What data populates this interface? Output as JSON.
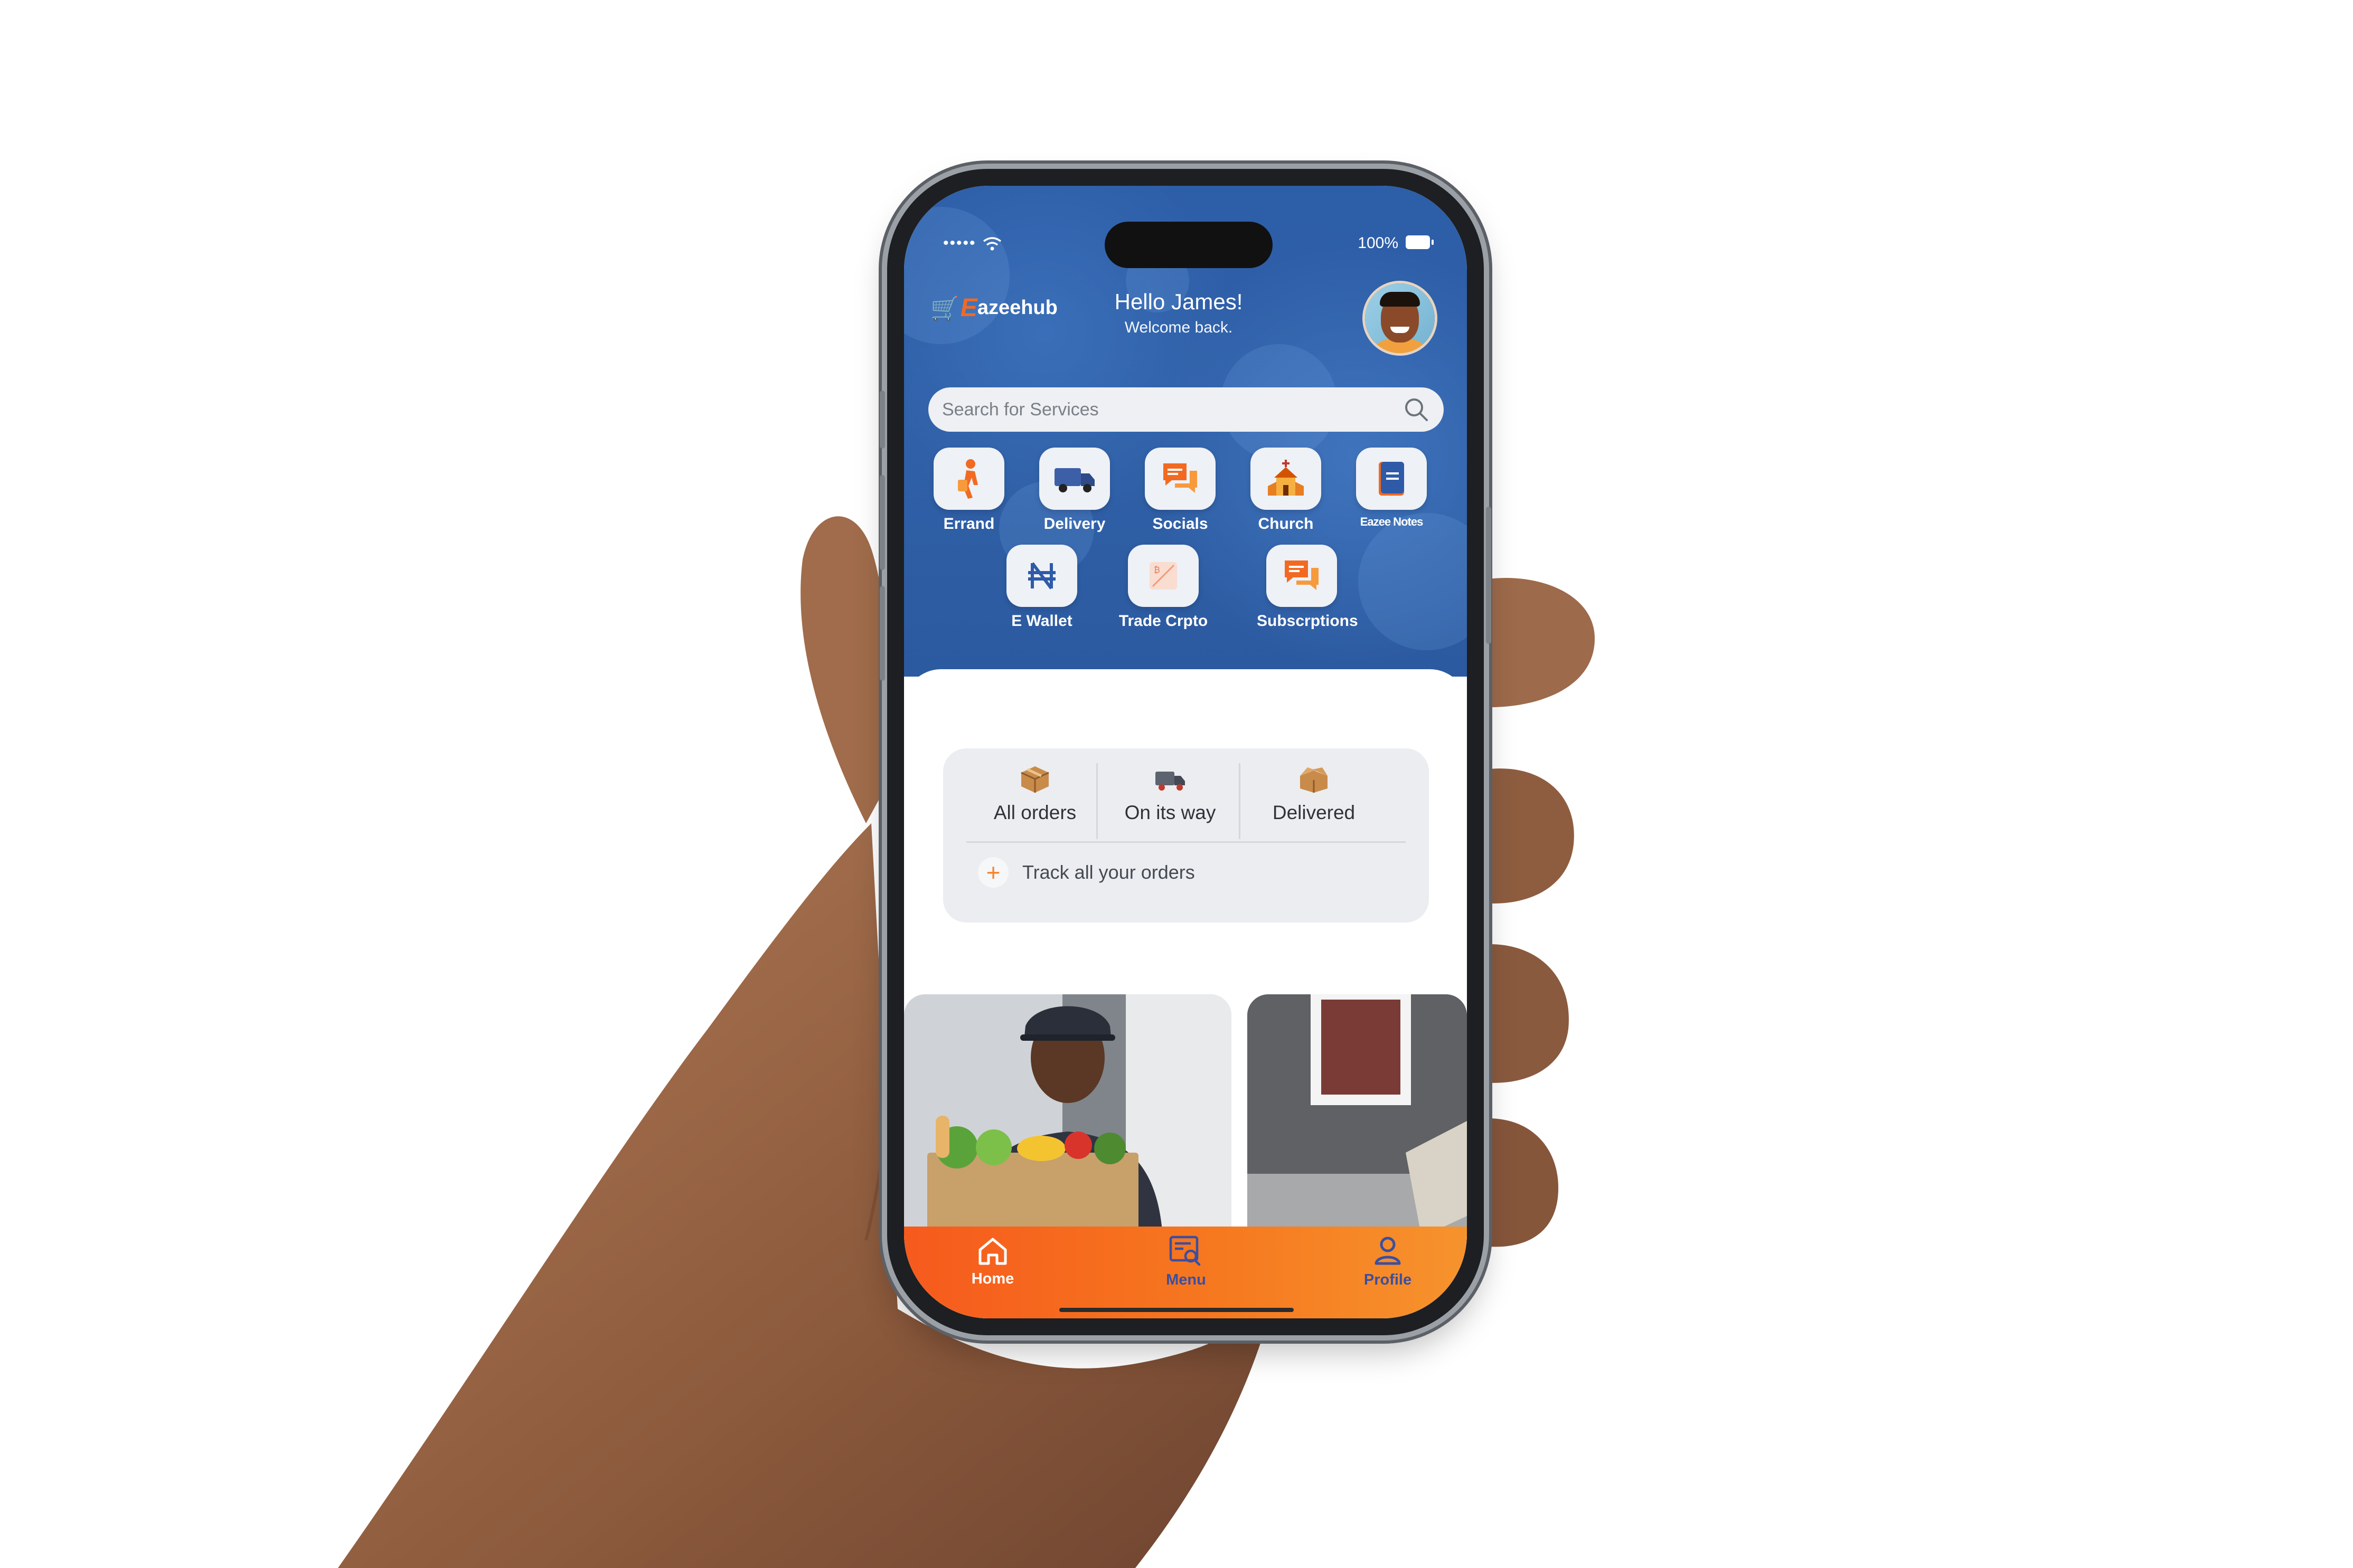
{
  "status_bar": {
    "signal": "•••••",
    "battery": "100%"
  },
  "header": {
    "logo_prefix": "E",
    "logo_text": "azeehub",
    "greeting": "Hello James!",
    "subtitle": "Welcome back."
  },
  "search": {
    "placeholder": "Search for Services"
  },
  "services": [
    {
      "label": "Errand",
      "icon": "walking-person-icon"
    },
    {
      "label": "Delivery",
      "icon": "delivery-truck-icon"
    },
    {
      "label": "Socials",
      "icon": "chat-bubbles-icon"
    },
    {
      "label": "Church",
      "icon": "church-icon"
    },
    {
      "label": "Eazee Notes",
      "icon": "notes-icon"
    },
    {
      "label": "E Wallet",
      "icon": "naira-icon"
    },
    {
      "label": "Trade Crpto",
      "icon": "crypto-icon"
    },
    {
      "label": "Subscrptions",
      "icon": "chat-bubbles-icon"
    }
  ],
  "orders": {
    "tabs": [
      {
        "label": "All orders",
        "icon": "package-icon"
      },
      {
        "label": "On its way",
        "icon": "truck-icon"
      },
      {
        "label": "Delivered",
        "icon": "open-package-icon"
      }
    ],
    "track_label": "Track all your orders"
  },
  "nav": {
    "home": "Home",
    "menu": "Menu",
    "profile": "Profile"
  },
  "colors": {
    "hero_blue": "#2d5ea8",
    "accent_orange": "#f6781f",
    "nav_inactive": "#3b4fa0"
  }
}
